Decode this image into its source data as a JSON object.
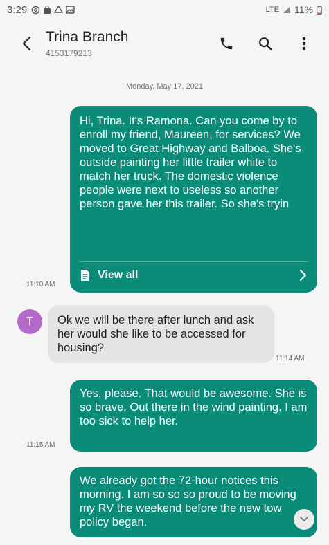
{
  "status_bar": {
    "time": "3:29",
    "network": "LTE",
    "battery": "11%"
  },
  "header": {
    "contact_name": "Trina Branch",
    "contact_number": "4153179213",
    "icons": [
      "back-arrow-icon",
      "phone-icon",
      "search-icon",
      "more-vert-icon"
    ]
  },
  "conversation": {
    "date": "Monday, May 17, 2021",
    "messages": [
      {
        "direction": "outgoing",
        "text": "Hi, Trina. It's Ramona.  Can you come by to enroll my friend, Maureen, for services?  We moved to Great Highway and Balboa.  She's outside painting her little trailer white to match her truck.  The domestic violence people were next to useless so another person gave her this trailer.  So she's tryin",
        "time": "11:10 AM",
        "view_all_label": "View all"
      },
      {
        "direction": "incoming",
        "avatar_initial": "T",
        "text": "Ok we will be there after lunch and ask her would she like to be accessed for housing?",
        "time": "11:14 AM"
      },
      {
        "direction": "outgoing",
        "text": "Yes, please.  That would be awesome.  She is so brave.  Out there in the wind painting.  I am too sick to help her.",
        "time": "11:15 AM"
      },
      {
        "direction": "outgoing",
        "text": "We already got the 72-hour notices this morning.  I am so so so proud to be moving my RV the weekend before the new tow policy began.",
        "time": ""
      }
    ]
  },
  "colors": {
    "outgoing_bubble": "#0b8c79",
    "incoming_bubble": "#e4e4e4",
    "avatar": "#b56ac9"
  }
}
